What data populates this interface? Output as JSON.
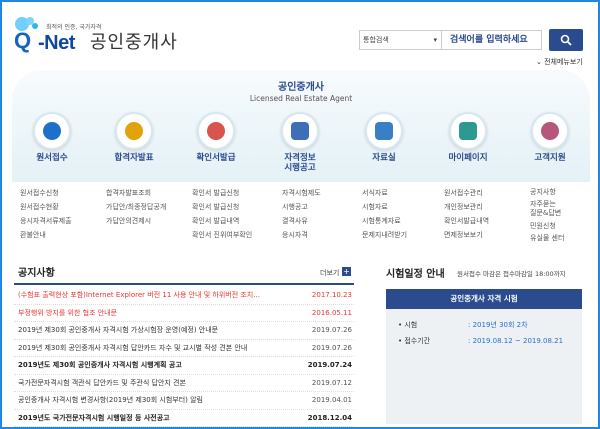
{
  "header": {
    "logo_small": "최적의 인증, 국가자격",
    "logo_q": "Q",
    "logo_net": "-Net",
    "site_title": "공인중개사",
    "search_select": "통합검색",
    "search_placeholder": "검색어를 입력하세요",
    "sitemap": "전체메뉴보기"
  },
  "banner": {
    "title": "공인중개사",
    "subtitle": "Licensed Real Estate Agent",
    "menu": [
      {
        "label": "원서접수",
        "icon": "document-icon",
        "color": "#1e6fc9"
      },
      {
        "label": "합격자발표",
        "icon": "megaphone-icon",
        "color": "#e2a20a"
      },
      {
        "label": "확인서발급",
        "icon": "printer-icon",
        "color": "#d9534f"
      },
      {
        "label": "자격정보\n시행공고",
        "icon": "id-card-icon",
        "color": "#3d6fb8"
      },
      {
        "label": "자료실",
        "icon": "folder-icon",
        "color": "#3a7fc4"
      },
      {
        "label": "마이페이지",
        "icon": "monitor-icon",
        "color": "#2e9a8f"
      },
      {
        "label": "고객지원",
        "icon": "handshake-icon",
        "color": "#b5567a"
      }
    ]
  },
  "submenu": [
    [
      "원서접수신청",
      "원서접수현황",
      "응시자격서류제출",
      "환불안내"
    ],
    [
      "합격자발표조회",
      "가답안/최종정답공개",
      "가답안의견제시"
    ],
    [
      "확인서 발급신청",
      "확인서 발급신청",
      "확인서 발급내역",
      "확인서 진위여부확인"
    ],
    [
      "자격시험제도",
      "시행공고",
      "결격사유",
      "응시자격"
    ],
    [
      "서식자료",
      "시험자료",
      "시험통계자료",
      "문제지내려받기"
    ],
    [
      "원서접수관리",
      "개인정보관리",
      "확인서발급내역",
      "면제정보보기"
    ],
    [
      "공지사항",
      "자주묻는\n질문&답변",
      "민원신청",
      "유실물 센터"
    ]
  ],
  "notice": {
    "title": "공지사항",
    "more": "더보기",
    "rows": [
      {
        "text": "(수험표 출력현상 포함)Internet Explorer 버전 11 사용 안내 및 하위버전 조치...",
        "date": "2017.10.23",
        "style": "red"
      },
      {
        "text": "부정행위 방지를 위한 협조 안내문",
        "date": "2016.05.11",
        "style": "red"
      },
      {
        "text": "2019년 제30회 공인중개사 자격시험 가상시험장 운영(예정) 안내문",
        "date": "2019.07.26",
        "style": ""
      },
      {
        "text": "2019년 제30회 공인중개사 자격시험 답안카드 자수 및 교시별 작성 견본 안내",
        "date": "2019.07.26",
        "style": ""
      },
      {
        "text": "2019년도 제30회 공인중개사 자격시험 시행계획 공고",
        "date": "2019.07.24",
        "style": "bold"
      },
      {
        "text": "국가전문자격시험 객관식 답안카드 및 주관식 답안지 견본",
        "date": "2019.07.12",
        "style": ""
      },
      {
        "text": "공인중개사 자격시험 변경사항(2019년 제30회 시험부터) 알림",
        "date": "2019.04.01",
        "style": ""
      },
      {
        "text": "2019년도 국가전문자격시험 시행일정 등 사전공고",
        "date": "2018.12.04",
        "style": "bold"
      }
    ]
  },
  "schedule": {
    "title": "시험일정 안내",
    "note": "원서접수 마감은 접수마감일 18:00까지",
    "head": "공인중개사 자격 시험",
    "rows": [
      {
        "key": "시험",
        "value": "2019년 30회 2차"
      },
      {
        "key": "접수기간",
        "value": "2019.08.12 ~ 2019.08.21"
      }
    ]
  }
}
